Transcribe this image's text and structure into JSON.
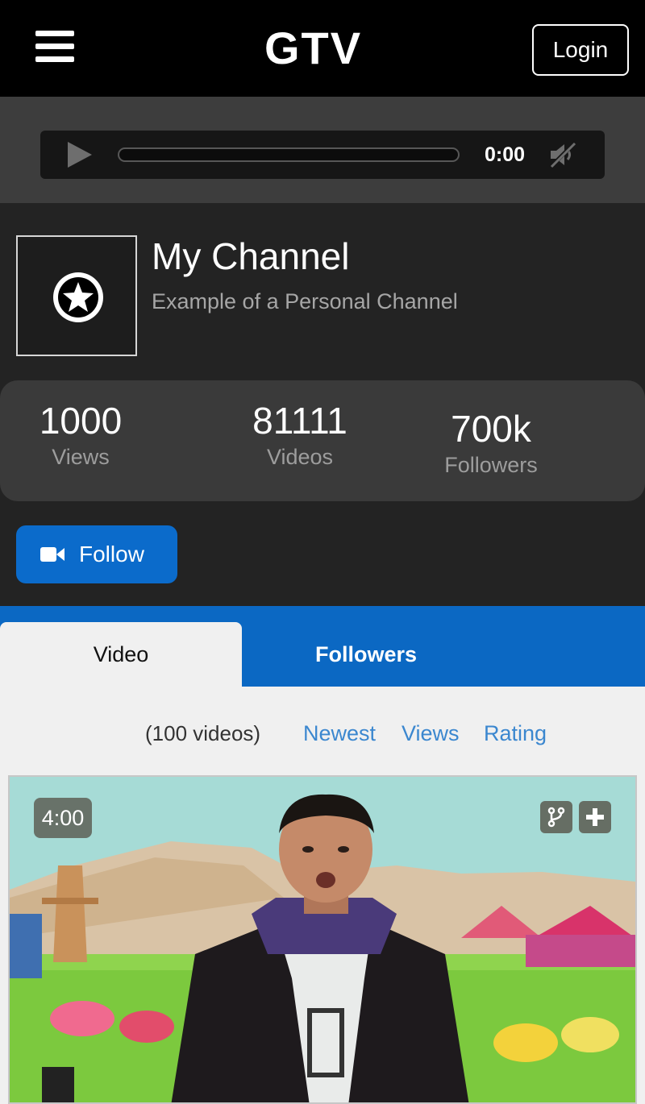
{
  "header": {
    "logo": "GTV",
    "login_label": "Login"
  },
  "audio_player": {
    "time": "0:00",
    "progress": 0,
    "icons": {
      "play": "play-icon",
      "mute": "volume-muted-icon"
    }
  },
  "channel": {
    "title": "My Channel",
    "subtitle": "Example of a Personal Channel",
    "avatar_icon": "star-circle-icon",
    "stats": [
      {
        "value": "1000",
        "label": "Views"
      },
      {
        "value": "81111",
        "label": "Videos"
      },
      {
        "value": "700k",
        "label": "Followers"
      }
    ],
    "follow_label": "Follow",
    "follow_icon": "video-camera-icon"
  },
  "tabs": [
    {
      "label": "Video",
      "active": true
    },
    {
      "label": "Followers",
      "active": false
    }
  ],
  "sort_bar": {
    "count_text": "(100 videos)",
    "options": [
      "Newest",
      "Views",
      "Rating"
    ]
  },
  "videos": [
    {
      "duration": "4:00",
      "actions": [
        "fork-icon",
        "plus-icon"
      ]
    }
  ],
  "colors": {
    "accent_blue": "#0b6bcb",
    "link_blue": "#3b87cf",
    "header_bg": "#000000",
    "channel_bg": "#232323"
  }
}
